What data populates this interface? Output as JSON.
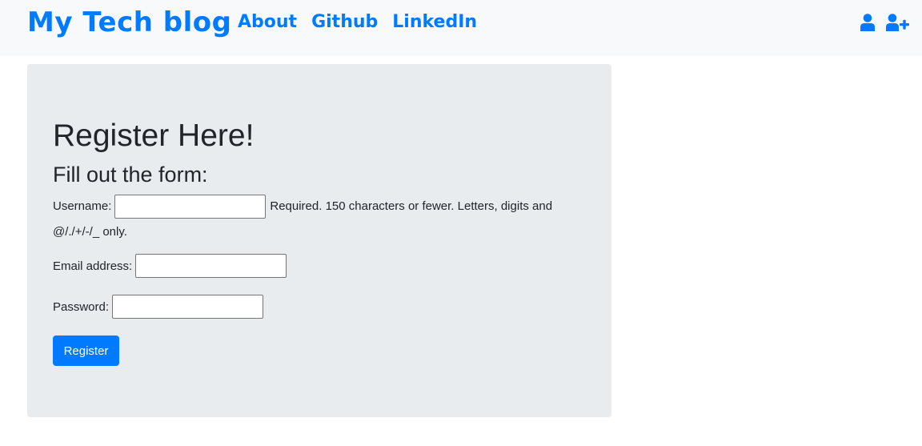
{
  "navbar": {
    "brand": "My Tech blog",
    "links": [
      {
        "label": "About"
      },
      {
        "label": "Github"
      },
      {
        "label": "LinkedIn"
      }
    ],
    "icons": [
      "user-icon",
      "user-plus-icon"
    ],
    "accent_color": "#007bff"
  },
  "form": {
    "title": "Register Here!",
    "subtitle": "Fill out the form:",
    "username": {
      "label": "Username:",
      "value": "",
      "help_line1": "Required. 150 characters or fewer. Letters, digits and",
      "help_line2": "@/./+/-/_ only."
    },
    "email": {
      "label": "Email address:",
      "value": ""
    },
    "password": {
      "label": "Password:",
      "value": ""
    },
    "submit_label": "Register"
  },
  "colors": {
    "navbar_bg": "#f8f9fa",
    "card_bg": "#e9ecef",
    "primary": "#007bff"
  }
}
